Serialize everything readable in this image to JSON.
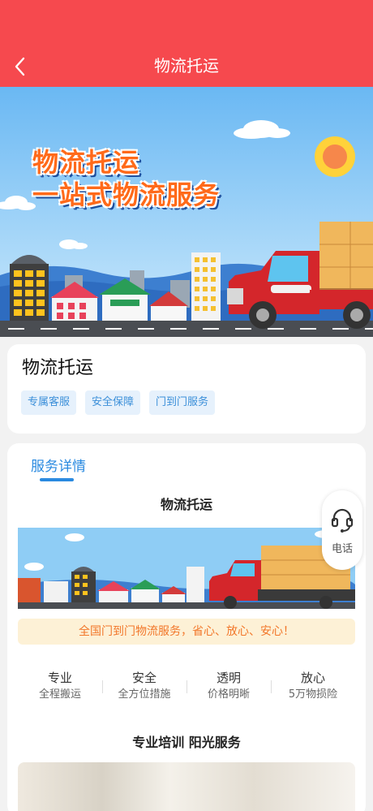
{
  "header": {
    "title": "物流托运",
    "back_icon": "chevron-left-icon"
  },
  "hero": {
    "line1": "物流托运",
    "line2": "一站式物流服务"
  },
  "info": {
    "title": "物流托运",
    "tags": [
      "专属客服",
      "安全保障",
      "门到门服务"
    ]
  },
  "detail": {
    "tab_label": "服务详情",
    "section_title": "物流托运",
    "slogan": "全国门到门物流服务，省心、放心、安心！",
    "features": [
      {
        "title": "专业",
        "subtitle": "全程搬运"
      },
      {
        "title": "安全",
        "subtitle": "全方位措施"
      },
      {
        "title": "透明",
        "subtitle": "价格明晰"
      },
      {
        "title": "放心",
        "subtitle": "5万物损险"
      }
    ],
    "section2_title": "专业培训 阳光服务"
  },
  "phone": {
    "label": "电话",
    "icon": "headset-icon"
  },
  "colors": {
    "header": "#f6494e",
    "accent_blue": "#2a8ae0",
    "tag_bg": "#e6f1fc",
    "slogan_bg": "#fdf1d6",
    "slogan_text": "#f2772a",
    "hero_text": "#ff6a1a"
  }
}
